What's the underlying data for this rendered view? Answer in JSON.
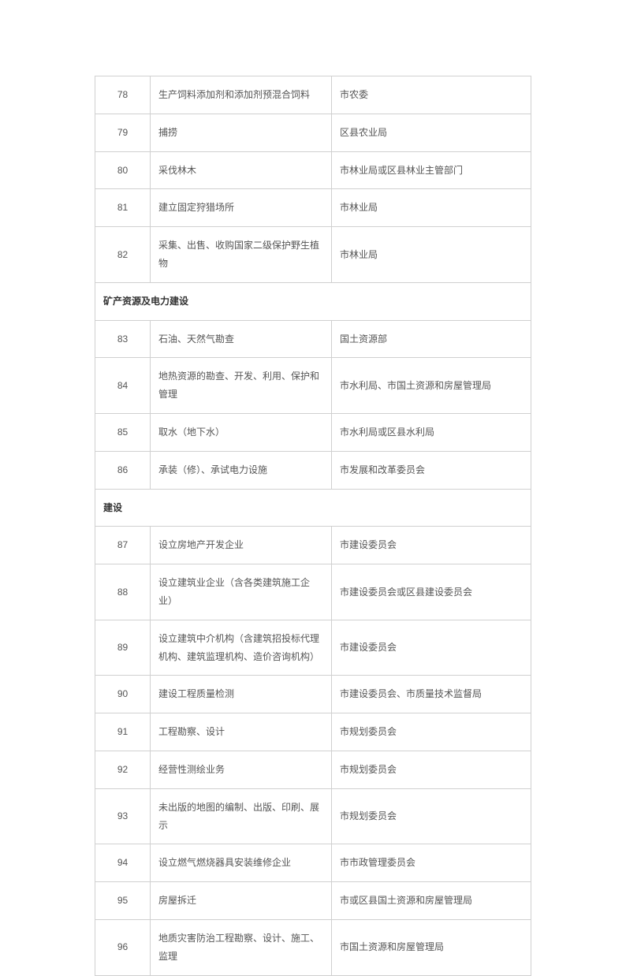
{
  "sections": [
    {
      "rows": [
        {
          "num": "78",
          "item": "生产饲料添加剂和添加剂预混合饲料",
          "dept": "市农委"
        },
        {
          "num": "79",
          "item": "捕捞",
          "dept": "区县农业局"
        },
        {
          "num": "80",
          "item": "采伐林木",
          "dept": "市林业局或区县林业主管部门"
        },
        {
          "num": "81",
          "item": "建立固定狩猎场所",
          "dept": "市林业局"
        },
        {
          "num": "82",
          "item": "采集、出售、收购国家二级保护野生植物",
          "dept": "市林业局"
        }
      ]
    },
    {
      "header": "矿产资源及电力建设",
      "rows": [
        {
          "num": "83",
          "item": "石油、天然气勘查",
          "dept": "国土资源部"
        },
        {
          "num": "84",
          "item": "地热资源的勘查、开发、利用、保护和管理",
          "dept": "市水利局、市国土资源和房屋管理局"
        },
        {
          "num": "85",
          "item": "取水（地下水）",
          "dept": "市水利局或区县水利局"
        },
        {
          "num": "86",
          "item": "承装（修）、承试电力设施",
          "dept": "市发展和改革委员会"
        }
      ]
    },
    {
      "header": "建设",
      "rows": [
        {
          "num": "87",
          "item": "设立房地产开发企业",
          "dept": "市建设委员会"
        },
        {
          "num": "88",
          "item": "设立建筑业企业（含各类建筑施工企业）",
          "dept": "市建设委员会或区县建设委员会"
        },
        {
          "num": "89",
          "item": "设立建筑中介机构（含建筑招投标代理机构、建筑监理机构、造价咨询机构）",
          "dept": "市建设委员会"
        },
        {
          "num": "90",
          "item": "建设工程质量检测",
          "dept": "市建设委员会、市质量技术监督局"
        },
        {
          "num": "91",
          "item": "工程勘察、设计",
          "dept": "市规划委员会"
        },
        {
          "num": "92",
          "item": "经营性测绘业务",
          "dept": "市规划委员会"
        },
        {
          "num": "93",
          "item": "未出版的地图的编制、出版、印刷、展示",
          "dept": "市规划委员会"
        },
        {
          "num": "94",
          "item": "设立燃气燃烧器具安装维修企业",
          "dept": "市市政管理委员会"
        },
        {
          "num": "95",
          "item": "房屋拆迁",
          "dept": "市或区县国土资源和房屋管理局"
        },
        {
          "num": "96",
          "item": "地质灾害防治工程勘察、设计、施工、监理",
          "dept": "市国土资源和房屋管理局"
        }
      ]
    }
  ]
}
